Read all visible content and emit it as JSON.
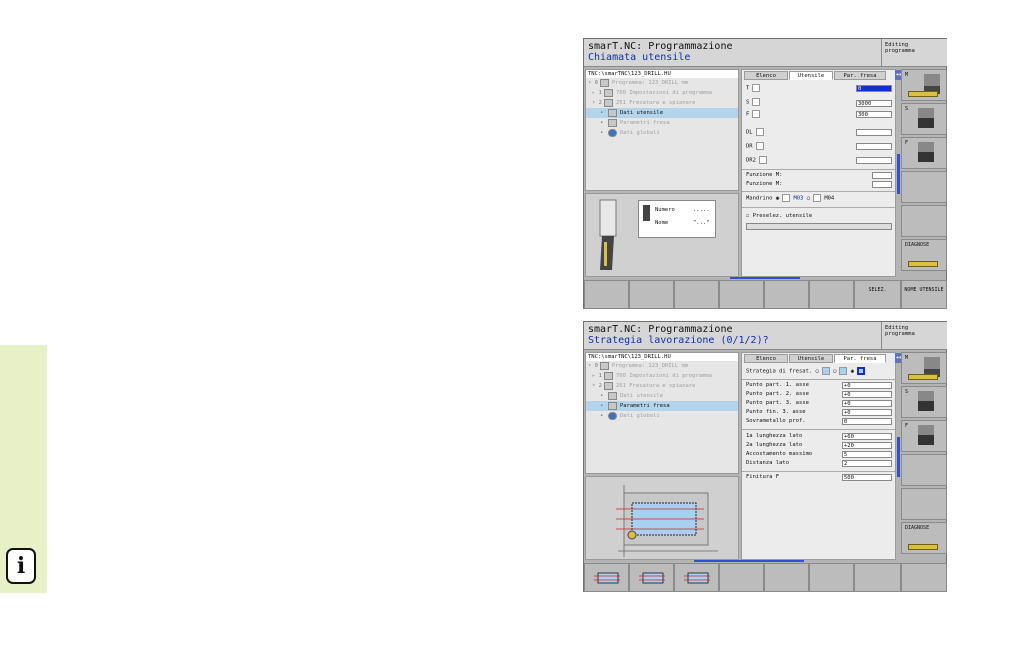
{
  "info_icon": "info-icon",
  "screens": [
    {
      "title_line1": "smarT.NC: Programmazione",
      "title_line2": "Chiamata utensile",
      "mode_line1": "Editing",
      "mode_line2": "programma",
      "path": "TNC:\\smarTNC\\123_DRILL.HU",
      "tree": [
        {
          "mark": "▿ 0",
          "label": "Programma: 123_DRILL mm",
          "on": false
        },
        {
          "mark": "▹ 1",
          "label": "700 Impostazioni di programma",
          "on": false
        },
        {
          "mark": "▿ 2",
          "label": "251 Fresatura e spianare",
          "on": false
        },
        {
          "mark": "•",
          "label": "Dati utensile",
          "on": true
        },
        {
          "mark": "•",
          "label": "Parametri fresa",
          "on": false
        },
        {
          "mark": "•",
          "label": "Dati globali",
          "on": false
        }
      ],
      "tabs": [
        "Elenco",
        "Utensile",
        "Par. fresa"
      ],
      "active_tab": 1,
      "fields": {
        "t_label": "T",
        "t_value": "0",
        "s_label": "S",
        "s_value": "3000",
        "f_label": "F",
        "f_value": "300",
        "dl_label": "DL",
        "dr_label": "DR",
        "dr2_label": "DR2",
        "m1_label": "Funzione M:",
        "m2_label": "Funzione M:",
        "spindle_label": "Mandrino",
        "m03": "M03",
        "m04": "M04",
        "preselect_label": "Preselez. utensile"
      },
      "preview": {
        "numero_label": "Numero",
        "numero_value": ".....",
        "nome_label": "Nome",
        "nome_value": "\"...\""
      },
      "right_softkeys": [
        "M",
        "S",
        "F",
        "",
        "",
        "DIAGNOSE"
      ],
      "bottom_softkeys": [
        "",
        "",
        "",
        "",
        "",
        "",
        "SELEZ.",
        "NOME UTENSILE"
      ]
    },
    {
      "title_line1": "smarT.NC: Programmazione",
      "title_line2": "Strategia lavorazione (0/1/2)?",
      "mode_line1": "Editing",
      "mode_line2": "programma",
      "path": "TNC:\\smarTNC\\123_DRILL.HU",
      "tree": [
        {
          "mark": "▿ 0",
          "label": "Programma: 123_DRILL mm",
          "on": false
        },
        {
          "mark": "▹ 1",
          "label": "700 Impostazioni di programma",
          "on": false
        },
        {
          "mark": "▿ 2",
          "label": "251 Fresatura e spianare",
          "on": false
        },
        {
          "mark": "•",
          "label": "Dati utensile",
          "on": false
        },
        {
          "mark": "•",
          "label": "Parametri fresa",
          "on": true
        },
        {
          "mark": "•",
          "label": "Dati globali",
          "on": false
        }
      ],
      "tabs": [
        "Elenco",
        "Utensile",
        "Par. fresa"
      ],
      "active_tab": 2,
      "strategy_label": "Strategia di fresat.",
      "rows": [
        {
          "label": "Punto part. 1. asse",
          "value": "+0"
        },
        {
          "label": "Punto part. 2. asse",
          "value": "+0"
        },
        {
          "label": "Punto part. 3. asse",
          "value": "+0"
        },
        {
          "label": "Punto fin. 3. asse",
          "value": "+0"
        },
        {
          "label": "Sovrametallo prof.",
          "value": "0"
        },
        {
          "label": "1a lunghezza lato",
          "value": "+60"
        },
        {
          "label": "2a lunghezza lato",
          "value": "+20"
        },
        {
          "label": "Accostamento massimo",
          "value": "5"
        },
        {
          "label": "Distanza lato",
          "value": "2"
        },
        {
          "label": "Finitura F",
          "value": "500"
        }
      ],
      "right_softkeys": [
        "M",
        "S",
        "F",
        "",
        "",
        "DIAGNOSE"
      ],
      "bottom_softkeys": [
        "",
        "",
        "",
        "",
        "",
        "",
        "",
        ""
      ]
    }
  ]
}
